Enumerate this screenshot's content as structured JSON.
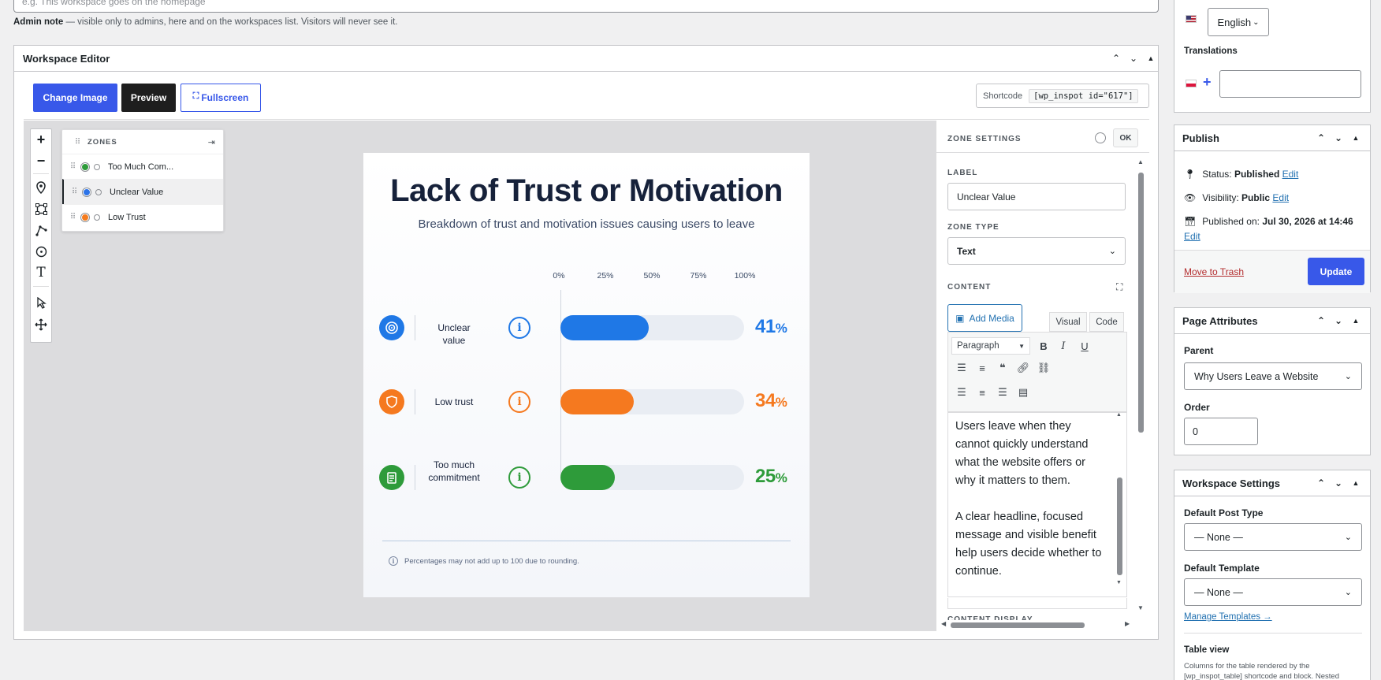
{
  "note": {
    "placeholder": "e.g. This workspace goes on the homepage",
    "admin_label": "Admin note",
    "admin_text": "— visible only to admins, here and on the workspaces list. Visitors will never see it."
  },
  "editor": {
    "title": "Workspace Editor",
    "buttons": {
      "change_image": "Change Image",
      "preview": "Preview",
      "fullscreen": "Fullscreen"
    },
    "shortcode_label": "Shortcode",
    "shortcode_value": "[wp_inspot id=\"617\"]"
  },
  "zones": {
    "title": "ZONES",
    "items": [
      {
        "label": "Too Much Com...",
        "color": "#2e9b3a"
      },
      {
        "label": "Unclear Value",
        "color": "#2d74e8"
      },
      {
        "label": "Low Trust",
        "color": "#f57c1f"
      }
    ]
  },
  "infographic": {
    "title": "Lack of Trust or Motivation",
    "subtitle": "Breakdown of trust and motivation issues causing users to leave",
    "ticks": [
      "0%",
      "25%",
      "50%",
      "75%",
      "100%"
    ],
    "rows": [
      {
        "label": "Unclear value",
        "value": 41,
        "pct_text": "41",
        "color": "#1f78e6"
      },
      {
        "label": "Low trust",
        "value": 34,
        "pct_text": "34",
        "color": "#f5791f"
      },
      {
        "label": "Too much commitment",
        "value": 25,
        "pct_text": "25",
        "color": "#2e9b3a"
      }
    ],
    "pct_sign": "%",
    "info_glyph": "i",
    "footnote": "Percentages may not add up to 100 due to rounding."
  },
  "zone_settings": {
    "title": "ZONE SETTINGS",
    "ok": "OK",
    "label_heading": "LABEL",
    "label_value": "Unclear Value",
    "type_heading": "ZONE TYPE",
    "type_value": "Text",
    "content_heading": "CONTENT",
    "add_media": "Add Media",
    "tab_visual": "Visual",
    "tab_code": "Code",
    "format_value": "Paragraph",
    "content_p1": "Users leave when they cannot quickly understand what the website offers or why it matters to them.",
    "content_p2": "A clear headline, focused message and visible benefit help users decide whether to continue.",
    "next_heading": "CONTENT DISPLAY"
  },
  "sidebar": {
    "language": "English",
    "translations_label": "Translations",
    "publish": {
      "title": "Publish",
      "status_label": "Status:",
      "status_value": "Published",
      "visibility_label": "Visibility:",
      "visibility_value": "Public",
      "published_on_label": "Published on:",
      "published_on_value": "Jul 30, 2026 at 14:46",
      "edit": "Edit",
      "trash": "Move to Trash",
      "update": "Update"
    },
    "page_attributes": {
      "title": "Page Attributes",
      "parent_label": "Parent",
      "parent_value": "Why Users Leave a Website",
      "order_label": "Order",
      "order_value": "0"
    },
    "workspace_settings": {
      "title": "Workspace Settings",
      "post_type_label": "Default Post Type",
      "post_type_value": "— None —",
      "template_label": "Default Template",
      "template_value": "— None —",
      "manage_templates": "Manage Templates →",
      "table_view_label": "Table view",
      "table_view_desc": "Columns for the table rendered by the [wp_inspot_table] shortcode and block. Nested"
    }
  },
  "colors": {
    "accent": "#3858e9",
    "link": "#2271b1",
    "trash": "#b32d2e"
  }
}
